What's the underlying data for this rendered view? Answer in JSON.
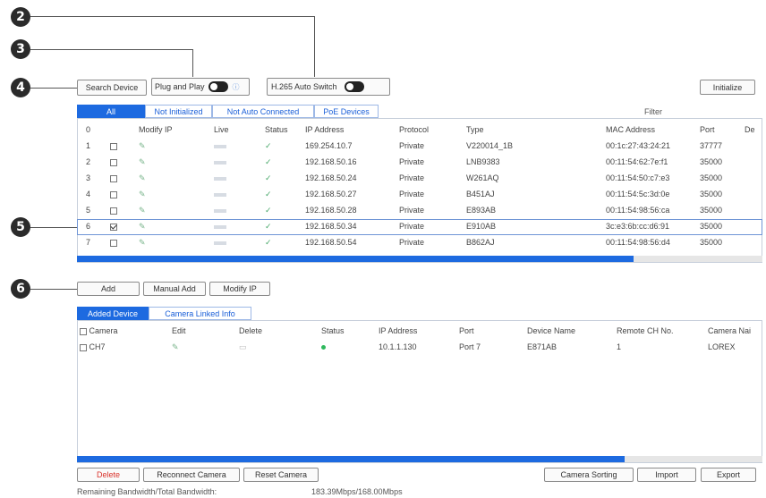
{
  "callouts": {
    "c2": "2",
    "c3": "3",
    "c4": "4",
    "c5": "5",
    "c6": "6"
  },
  "toolbar": {
    "search_device": "Search Device",
    "plug_and_play": "Plug and Play",
    "plug_and_play_on": true,
    "h265_auto_switch": "H.265 Auto Switch",
    "h265_on": true,
    "initialize": "Initialize"
  },
  "filter_tabs": [
    "All",
    "Not Initialized",
    "Not Auto Connected",
    "PoE Devices"
  ],
  "filter_label": "Filter",
  "search_table": {
    "headers": [
      "0",
      "",
      "Modify IP",
      "Live",
      "Status",
      "IP Address",
      "Protocol",
      "Type",
      "MAC Address",
      "Port",
      "De"
    ],
    "rows": [
      {
        "num": "1",
        "checked": false,
        "ip": "169.254.10.7",
        "protocol": "Private",
        "type": "V220014_1B",
        "mac": "00:1c:27:43:24:21",
        "port": "37777"
      },
      {
        "num": "2",
        "checked": false,
        "ip": "192.168.50.16",
        "protocol": "Private",
        "type": "LNB9383",
        "mac": "00:11:54:62:7e:f1",
        "port": "35000"
      },
      {
        "num": "3",
        "checked": false,
        "ip": "192.168.50.24",
        "protocol": "Private",
        "type": "W261AQ",
        "mac": "00:11:54:50:c7:e3",
        "port": "35000"
      },
      {
        "num": "4",
        "checked": false,
        "ip": "192.168.50.27",
        "protocol": "Private",
        "type": "B451AJ",
        "mac": "00:11:54:5c:3d:0e",
        "port": "35000"
      },
      {
        "num": "5",
        "checked": false,
        "ip": "192.168.50.28",
        "protocol": "Private",
        "type": "E893AB",
        "mac": "00:11:54:98:56:ca",
        "port": "35000"
      },
      {
        "num": "6",
        "checked": true,
        "ip": "192.168.50.34",
        "protocol": "Private",
        "type": "E910AB",
        "mac": "3c:e3:6b:cc:d6:91",
        "port": "35000"
      },
      {
        "num": "7",
        "checked": false,
        "ip": "192.168.50.54",
        "protocol": "Private",
        "type": "B862AJ",
        "mac": "00:11:54:98:56:d4",
        "port": "35000"
      }
    ]
  },
  "add_buttons": {
    "add": "Add",
    "manual_add": "Manual Add",
    "modify_ip": "Modify IP"
  },
  "added_tabs": [
    "Added Device",
    "Camera Linked Info"
  ],
  "added_table": {
    "headers": [
      "Camera",
      "Edit",
      "Delete",
      "Status",
      "IP Address",
      "Port",
      "Device Name",
      "Remote CH No.",
      "Camera Nai"
    ],
    "rows": [
      {
        "camera": "CH7",
        "ip": "10.1.1.130",
        "port": "Port 7",
        "device_name": "E871AB",
        "remote_ch": "1",
        "camera_name": "LOREX"
      }
    ]
  },
  "bottom_buttons": {
    "delete": "Delete",
    "reconnect": "Reconnect Camera",
    "reset": "Reset Camera",
    "sorting": "Camera Sorting",
    "import": "Import",
    "export": "Export"
  },
  "bandwidth": {
    "label": "Remaining Bandwidth/Total Bandwidth:",
    "value": "183.39Mbps/168.00Mbps"
  },
  "colors": {
    "accent": "#1d6ae0",
    "delete_red": "#d9322b",
    "status_green": "#2eb85c"
  }
}
